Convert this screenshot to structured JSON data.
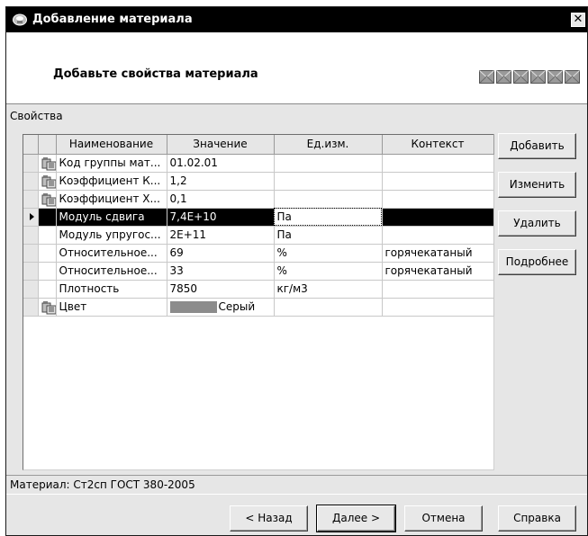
{
  "window": {
    "title": "Добавление материала",
    "close_glyph": "✕"
  },
  "header": {
    "text": "Добавьте свойства материала",
    "step_icons": [
      "envelope-icon",
      "envelope-icon",
      "envelope-icon",
      "envelope-icon",
      "envelope-icon",
      "envelope-icon"
    ]
  },
  "properties": {
    "label": "Свойства",
    "columns": [
      "Наименование",
      "Значение",
      "Ед.изм.",
      "Контекст"
    ],
    "rows": [
      {
        "icon": "book-icon",
        "name": "Код группы мат...",
        "value": "01.02.01",
        "unit": "",
        "context": "",
        "selected": false
      },
      {
        "icon": "book-icon",
        "name": "Коэффициент К...",
        "value": "1,2",
        "unit": "",
        "context": "",
        "selected": false
      },
      {
        "icon": "book-icon",
        "name": "Коэффициент Х...",
        "value": "0,1",
        "unit": "",
        "context": "",
        "selected": false
      },
      {
        "icon": "",
        "name": "Модуль сдвига",
        "value": "7,4E+10",
        "unit": "Па",
        "context": "",
        "selected": true
      },
      {
        "icon": "",
        "name": "Модуль упругос...",
        "value": "2E+11",
        "unit": "Па",
        "context": "",
        "selected": false
      },
      {
        "icon": "",
        "name": "Относительное...",
        "value": "69",
        "unit": "%",
        "context": "горячекатаный",
        "selected": false
      },
      {
        "icon": "",
        "name": "Относительное...",
        "value": "33",
        "unit": "%",
        "context": "горячекатаный",
        "selected": false
      },
      {
        "icon": "",
        "name": "Плотность",
        "value": "7850",
        "unit": "кг/м3",
        "context": "",
        "selected": false
      },
      {
        "icon": "book-icon",
        "name": "Цвет",
        "value": "Серый",
        "unit": "",
        "context": "",
        "selected": false,
        "swatch_color": "#8c8c8c"
      }
    ]
  },
  "side_buttons": {
    "add": "Добавить",
    "edit": "Изменить",
    "delete": "Удалить",
    "details": "Подробнее"
  },
  "material": {
    "text": "Материал: Ст2сп  ГОСТ 380-2005"
  },
  "footer_buttons": {
    "back": "< Назад",
    "next": "Далее >",
    "cancel": "Отмена",
    "help": "Справка"
  },
  "colors": {
    "titlebar": "#000000",
    "selection": "#000000",
    "dialog_bg": "#e6e6e6"
  }
}
